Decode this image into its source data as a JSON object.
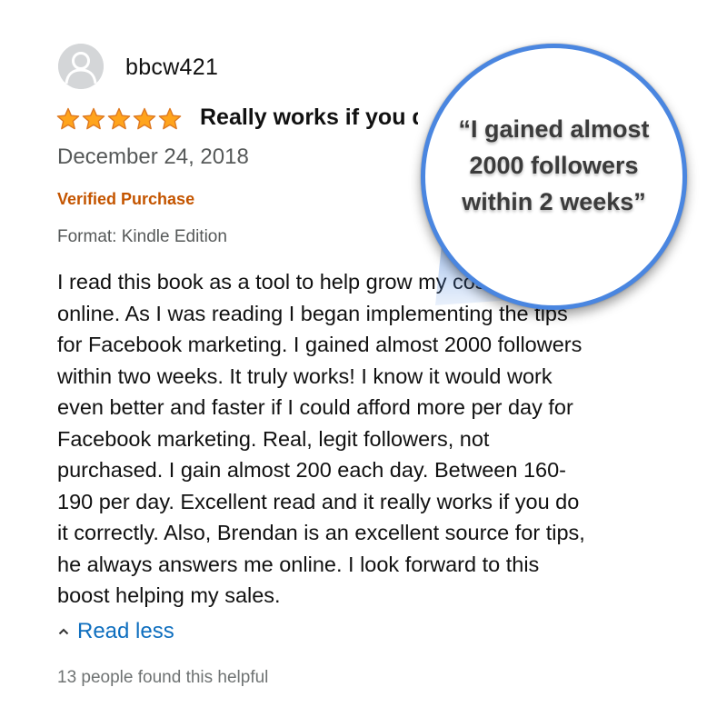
{
  "review": {
    "username": "bbcw421",
    "rating": 5,
    "rating_max": 5,
    "title": "Really works if you do it correctly",
    "date": "December 24, 2018",
    "verified": "Verified Purchase",
    "format": "Format: Kindle Edition",
    "body": "I read this book as a tool to help grow my cosmetic line\nonline. As I was reading I began implementing the tips\nfor Facebook marketing. I gained almost 2000 followers\nwithin two weeks. It truly works! I know it would work\neven better and faster if I could afford more per day for\nFacebook marketing. Real, legit followers, not\npurchased. I gain almost 200 each day. Between 160-\n190 per day. Excellent read and it really works if you do\nit correctly. Also, Brendan is an excellent source for tips,\nhe always answers me online. I look forward to this\nboost helping my sales.",
    "read_less": "Read less",
    "helpful": "13 people found this helpful"
  },
  "callout": {
    "quote": "“I gained almost 2000 followers within 2 weeks”"
  },
  "icons": {
    "avatar": "default-user-icon",
    "star": "star-icon",
    "read_less": "caret-up-icon"
  },
  "colors": {
    "star_fill": "#ffa41c",
    "star_stroke": "#de7921",
    "verified": "#c45500",
    "link": "#0f6fbf",
    "muted_text": "#565959",
    "callout_border": "#4a86e0",
    "callout_pointer": "#4a86e0"
  }
}
